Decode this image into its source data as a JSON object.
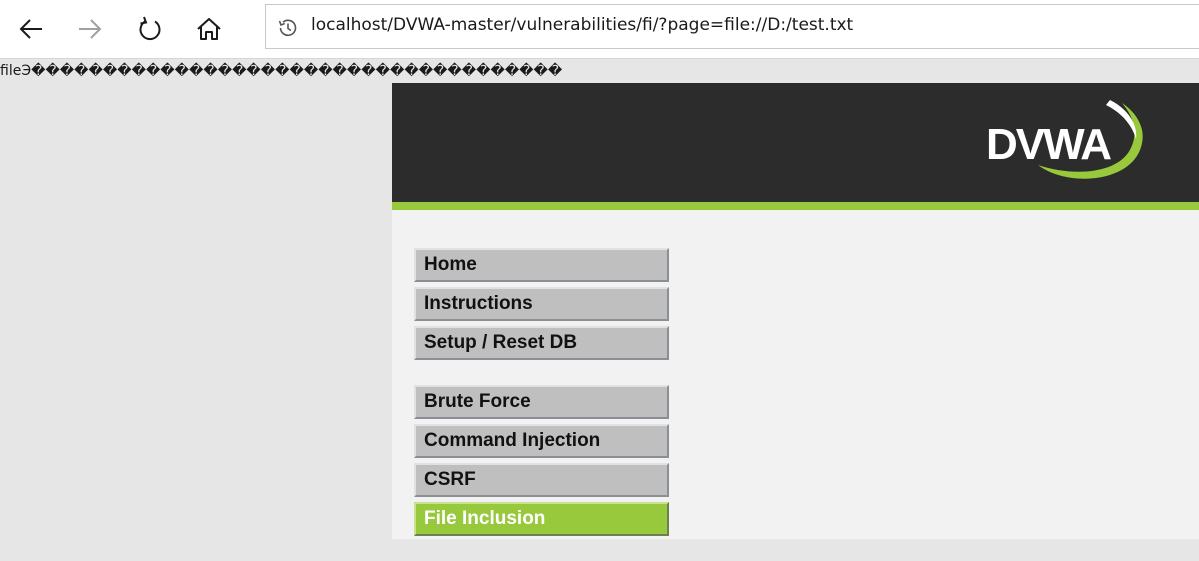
{
  "browser": {
    "url": "localhost/DVWA-master/vulnerabilities/fi/?page=file://D:/test.txt",
    "icons": {
      "back": "back-arrow-icon",
      "forward": "forward-arrow-icon",
      "reload": "reload-icon",
      "home": "home-icon",
      "history": "history-icon"
    }
  },
  "page": {
    "file_output": "fileЭ�������������������������������������"
  },
  "header": {
    "logo_text": "DVWA",
    "accent_color": "#98c93c"
  },
  "menu": {
    "groups": [
      [
        "Home",
        "Instructions",
        "Setup / Reset DB"
      ],
      [
        "Brute Force",
        "Command Injection",
        "CSRF",
        "File Inclusion"
      ]
    ],
    "selected": "File Inclusion"
  }
}
